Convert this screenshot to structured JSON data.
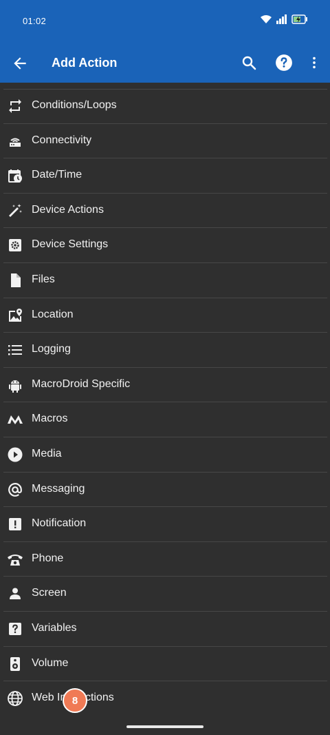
{
  "status_bar": {
    "time": "01:02"
  },
  "app_bar": {
    "title": "Add Action"
  },
  "categories": [
    {
      "label": "Conditions/Loops",
      "icon": "repeat-icon"
    },
    {
      "label": "Connectivity",
      "icon": "router-icon"
    },
    {
      "label": "Date/Time",
      "icon": "calendar-clock-icon"
    },
    {
      "label": "Device Actions",
      "icon": "magic-wand-icon"
    },
    {
      "label": "Device Settings",
      "icon": "settings-box-icon"
    },
    {
      "label": "Files",
      "icon": "file-icon"
    },
    {
      "label": "Location",
      "icon": "map-pin-icon"
    },
    {
      "label": "Logging",
      "icon": "list-icon"
    },
    {
      "label": "MacroDroid Specific",
      "icon": "android-robot-icon"
    },
    {
      "label": "Macros",
      "icon": "macrodroid-logo-icon"
    },
    {
      "label": "Media",
      "icon": "play-circle-icon"
    },
    {
      "label": "Messaging",
      "icon": "at-sign-icon"
    },
    {
      "label": "Notification",
      "icon": "alert-box-icon"
    },
    {
      "label": "Phone",
      "icon": "phone-icon"
    },
    {
      "label": "Screen",
      "icon": "person-icon"
    },
    {
      "label": "Variables",
      "icon": "question-box-icon"
    },
    {
      "label": "Volume",
      "icon": "speaker-icon"
    },
    {
      "label": "Web Interactions",
      "icon": "globe-icon"
    }
  ],
  "overlay_badge": "8"
}
